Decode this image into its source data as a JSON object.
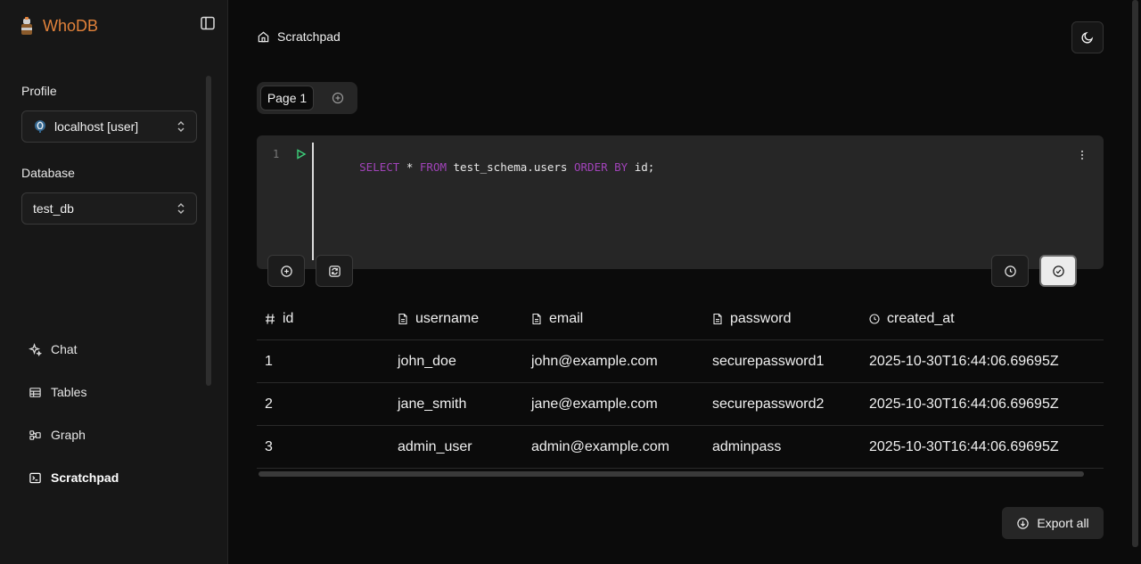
{
  "app": {
    "name": "WhoDB"
  },
  "sidebar": {
    "profile_label": "Profile",
    "profile_value": "localhost [user]",
    "database_label": "Database",
    "database_value": "test_db",
    "nav": [
      {
        "label": "Chat",
        "icon": "sparkles-icon"
      },
      {
        "label": "Tables",
        "icon": "table-icon"
      },
      {
        "label": "Graph",
        "icon": "graph-icon"
      },
      {
        "label": "Scratchpad",
        "icon": "terminal-icon",
        "active": true
      }
    ]
  },
  "breadcrumb": {
    "label": "Scratchpad"
  },
  "tabs": [
    {
      "label": "Page 1"
    }
  ],
  "editor": {
    "line_number": "1",
    "tokens": [
      {
        "text": "SELECT",
        "kw": true
      },
      {
        "text": " * ",
        "kw": false
      },
      {
        "text": "FROM",
        "kw": true
      },
      {
        "text": " test_schema.users ",
        "kw": false
      },
      {
        "text": "ORDER BY",
        "kw": true
      },
      {
        "text": " id;",
        "kw": false
      }
    ]
  },
  "table": {
    "columns": [
      {
        "label": "id",
        "icon": "hash-icon"
      },
      {
        "label": "username",
        "icon": "file-text-icon"
      },
      {
        "label": "email",
        "icon": "file-text-icon"
      },
      {
        "label": "password",
        "icon": "file-text-icon"
      },
      {
        "label": "created_at",
        "icon": "clock-icon"
      }
    ],
    "rows": [
      [
        "1",
        "john_doe",
        "john@example.com",
        "securepassword1",
        "2025-10-30T16:44:06.69695Z"
      ],
      [
        "2",
        "jane_smith",
        "jane@example.com",
        "securepassword2",
        "2025-10-30T16:44:06.69695Z"
      ],
      [
        "3",
        "admin_user",
        "admin@example.com",
        "adminpass",
        "2025-10-30T16:44:06.69695Z"
      ]
    ]
  },
  "export": {
    "label": "Export all"
  },
  "colors": {
    "brand": "#e2823a",
    "keyword": "#a043b8",
    "run": "#3ccf7a"
  }
}
